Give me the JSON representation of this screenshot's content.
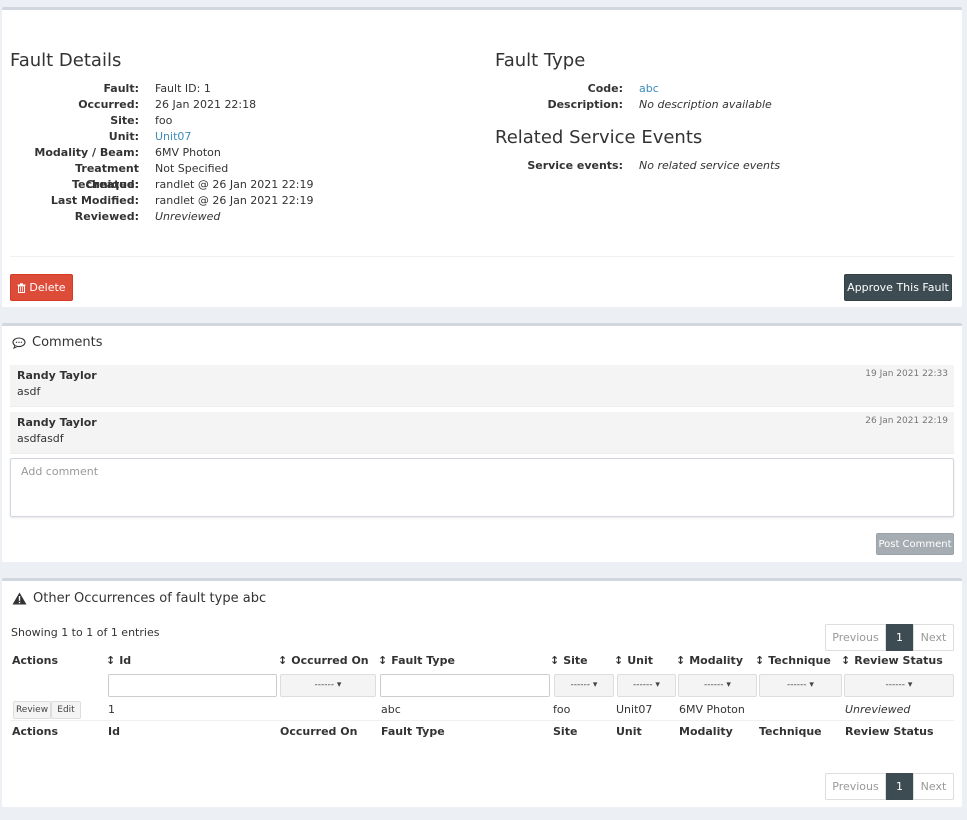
{
  "fault_details": {
    "title": "Fault Details",
    "rows": [
      {
        "label": "Fault:",
        "value": "Fault ID: 1"
      },
      {
        "label": "Occurred:",
        "value": "26 Jan 2021 22:18"
      },
      {
        "label": "Site:",
        "value": "foo"
      },
      {
        "label": "Unit:",
        "value": "Unit07"
      },
      {
        "label": "Modality / Beam:",
        "value": "6MV Photon"
      },
      {
        "label": "Treatment Technique:",
        "value": "Not Specified"
      },
      {
        "label": "Created:",
        "value": "randlet @ 26 Jan 2021 22:19"
      },
      {
        "label": "Last Modified:",
        "value": "randlet @ 26 Jan 2021 22:19"
      },
      {
        "label": "Reviewed:",
        "value": "Unreviewed"
      }
    ]
  },
  "fault_type": {
    "title": "Fault Type",
    "code_label": "Code:",
    "code_value": "abc",
    "desc_label": "Description:",
    "desc_value": "No description available"
  },
  "related": {
    "title": "Related Service Events",
    "label": "Service events:",
    "value": "No related service events"
  },
  "actions": {
    "delete_label": "Delete",
    "approve_label": "Approve This Fault"
  },
  "comments": {
    "title": "Comments",
    "items": [
      {
        "author": "Randy Taylor",
        "text": "asdf",
        "time": "19 Jan 2021 22:33"
      },
      {
        "author": "Randy Taylor",
        "text": "asdfasdf",
        "time": "26 Jan 2021 22:19"
      }
    ],
    "placeholder": "Add comment",
    "post_label": "Post Comment"
  },
  "occurrences": {
    "title": "Other Occurrences of fault type abc",
    "showing": "Showing 1 to 1 of 1 entries",
    "pager": {
      "prev": "Previous",
      "page": "1",
      "next": "Next"
    },
    "columns": [
      "Actions",
      "Id",
      "Occurred On",
      "Fault Type",
      "Site",
      "Unit",
      "Modality",
      "Technique",
      "Review Status"
    ],
    "select_placeholder": "------",
    "row": {
      "review_label": "Review",
      "edit_label": "Edit",
      "id": "1",
      "occurred_on": "",
      "fault_type": "abc",
      "site": "foo",
      "unit": "Unit07",
      "modality": "6MV Photon",
      "technique": "",
      "review_status": "Unreviewed"
    }
  },
  "colors": {
    "danger": "#dd4b39",
    "dark": "#3d4b52",
    "link": "#3c8dbc"
  }
}
